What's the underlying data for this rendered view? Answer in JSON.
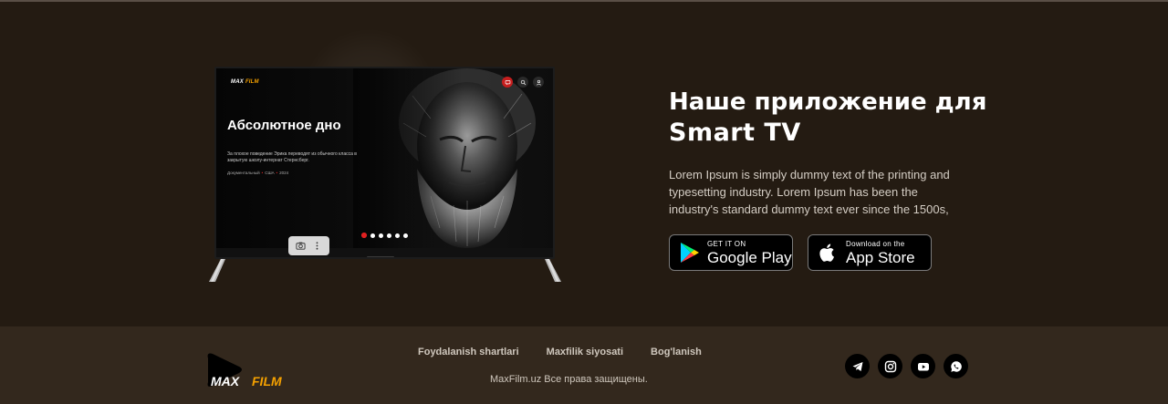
{
  "tv": {
    "logo_max": "MAX",
    "logo_film": "FILM",
    "title": "Абсолютное дно",
    "description": "За плохое поведение Эрика переводят из обычного класса в закрытую школу-интернат Стернсберг.",
    "meta_genre": "Документальный",
    "meta_country": "США",
    "meta_year": "2024",
    "meta_separator": "•",
    "slides": 6,
    "active_slide": 1,
    "icons": [
      "chat-icon",
      "search-icon",
      "user-icon"
    ]
  },
  "app": {
    "heading_line1": "Наше приложение для",
    "heading_line2": "Smart TV",
    "description": "Lorem Ipsum is simply dummy text of the printing and typesetting industry. Lorem Ipsum has been the industry's standard dummy text ever since the 1500s,",
    "google_play_small": "GET IT ON",
    "google_play_big": "Google Play",
    "app_store_small": "Download on the",
    "app_store_big": "App Store"
  },
  "footer": {
    "logo_max": "MAX",
    "logo_film": "FILM",
    "links": [
      "Foydalanish shartlari",
      "Maxfilik siyosati",
      "Bog'lanish"
    ],
    "copyright": "MaxFilm.uz Все права защищены.",
    "social": [
      "telegram-icon",
      "instagram-icon",
      "youtube-icon",
      "whatsapp-icon"
    ]
  },
  "colors": {
    "background": "#241b12",
    "footer_background": "#33281d",
    "accent_orange": "#f5a100",
    "accent_red": "#e02020"
  }
}
